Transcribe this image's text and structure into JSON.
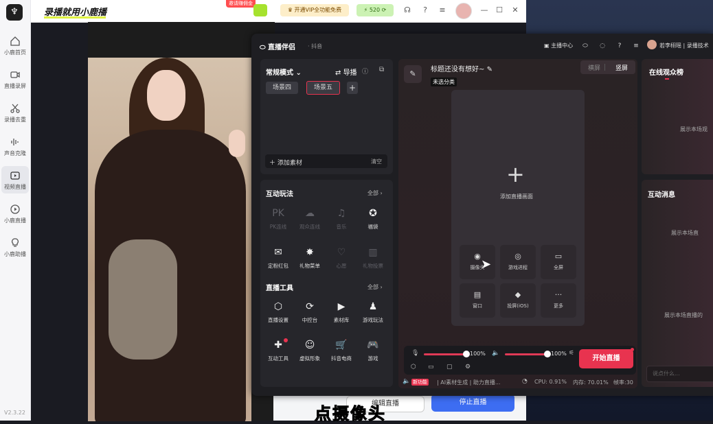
{
  "app": {
    "slogan": "录播就用小鹿播",
    "version": "V2.3.22"
  },
  "sidebar": {
    "items": [
      {
        "label": "小鹿首页",
        "icon": "home-icon"
      },
      {
        "label": "直播录屏",
        "icon": "video-camera-icon"
      },
      {
        "label": "录播去重",
        "icon": "scissors-icon"
      },
      {
        "label": "声音克隆",
        "icon": "waveform-icon"
      },
      {
        "label": "视频直播",
        "icon": "live-tv-icon"
      },
      {
        "label": "小鹿直播",
        "icon": "play-circle-icon"
      },
      {
        "label": "小鹿助播",
        "icon": "lightbulb-icon"
      }
    ],
    "active": "视频直播"
  },
  "topbar": {
    "promo_badge": "邀请赚佣金",
    "vip_label": "开通VIP全功能免费",
    "coins": "520"
  },
  "background": {
    "edit_btn": "编辑直播",
    "stop_btn": "停止直播",
    "caption": "点摄像头"
  },
  "window": {
    "title": "直播伴侣",
    "subtitle": "· 抖音",
    "host_center": "主播中心",
    "user": "若李栩瑶 | 录播技术"
  },
  "scenes": {
    "mode": "常规模式",
    "guide": "导播",
    "tabs": [
      "场景四",
      "场景五"
    ],
    "active_tab": "场景五",
    "add_material": "添加素材",
    "clear": "清空"
  },
  "interactive": {
    "title": "互动玩法",
    "all": "全部",
    "items": [
      {
        "label": "PK连线",
        "glyph": "PK",
        "enabled": false
      },
      {
        "label": "观众连线",
        "glyph": "☁",
        "enabled": false
      },
      {
        "label": "音乐",
        "glyph": "♫",
        "enabled": false
      },
      {
        "label": "福袋",
        "glyph": "✪",
        "enabled": true
      },
      {
        "label": "定粉红包",
        "glyph": "✉",
        "enabled": true
      },
      {
        "label": "礼物菜单",
        "glyph": "✸",
        "enabled": true
      },
      {
        "label": "心愿",
        "glyph": "♡",
        "enabled": false
      },
      {
        "label": "礼物投票",
        "glyph": "▥",
        "enabled": false
      }
    ]
  },
  "tools": {
    "title": "直播工具",
    "all": "全部",
    "items": [
      {
        "label": "直播设置",
        "glyph": "⬡"
      },
      {
        "label": "中控台",
        "glyph": "⟳"
      },
      {
        "label": "素材库",
        "glyph": "▶"
      },
      {
        "label": "游戏玩法",
        "glyph": "♟"
      },
      {
        "label": "互动工具",
        "glyph": "✚"
      },
      {
        "label": "虚拟形象",
        "glyph": "☺"
      },
      {
        "label": "抖音电商",
        "glyph": "🛒"
      },
      {
        "label": "游戏",
        "glyph": "🎮"
      }
    ]
  },
  "center": {
    "title": "标题还没有想好~",
    "category": "未选分类",
    "landscape": "横屏",
    "portrait": "竖屏",
    "add_screen": "添加直播画面",
    "sources": [
      {
        "label": "摄像头",
        "glyph": "◉"
      },
      {
        "label": "游戏进程",
        "glyph": "◎"
      },
      {
        "label": "全屏",
        "glyph": "▭"
      },
      {
        "label": "窗口",
        "glyph": "▤"
      },
      {
        "label": "投屏(iOS)",
        "glyph": ""
      },
      {
        "label": "更多",
        "glyph": "···"
      }
    ],
    "mic_volume": "100%",
    "speaker_volume": "100%",
    "mic_level": 1.0,
    "speaker_level": 1.0,
    "start_btn": "开始直播",
    "new_badge": "新功能",
    "ai_text": "| AI素材生成 | 助力直播...",
    "cpu": "CPU: 0.91%",
    "memory": "内存: 70.01%",
    "fps": "帧率:30"
  },
  "right": {
    "viewers_title": "在线观众榜",
    "viewers_empty": "展示本场观",
    "msg_title": "互动消息",
    "msg_empty1": "展示本场直",
    "msg_empty2": "展示本场直播的",
    "msg_placeholder": "说点什么..."
  }
}
